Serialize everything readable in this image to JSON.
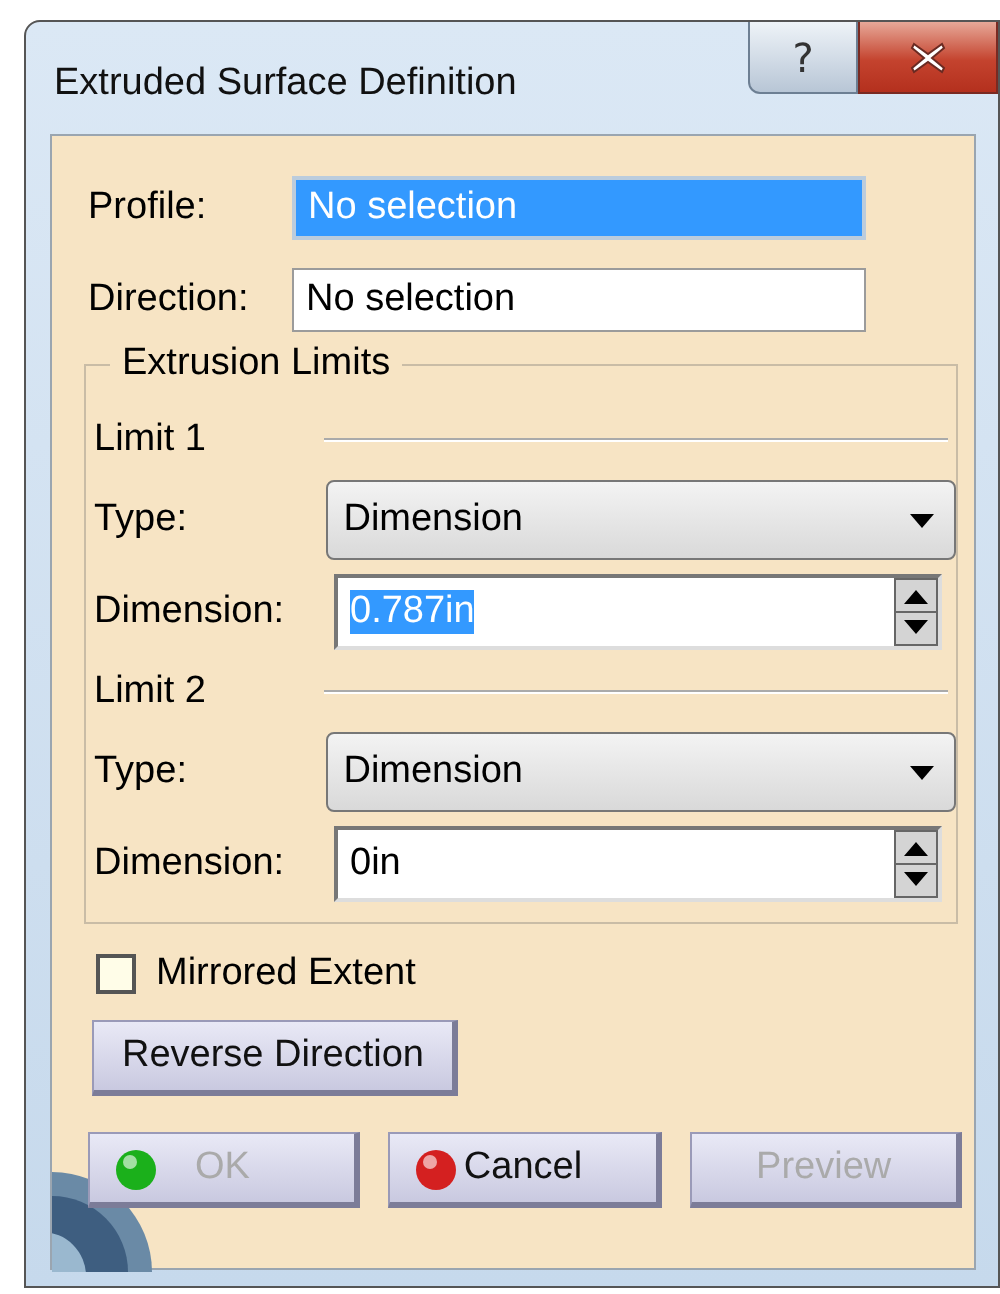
{
  "window": {
    "title": "Extruded Surface Definition",
    "help_button": "?"
  },
  "fields": [
    {
      "label": "Profile:",
      "value": "No selection",
      "selected": true
    },
    {
      "label": "Direction:",
      "value": "No selection",
      "selected": false
    }
  ],
  "group": {
    "title": "Extrusion Limits",
    "limits": [
      {
        "title": "Limit 1",
        "type_label": "Type:",
        "type_value": "Dimension",
        "dimension_label": "Dimension:",
        "dimension_value": "0.787in",
        "selected": true
      },
      {
        "title": "Limit 2",
        "type_label": "Type:",
        "type_value": "Dimension",
        "dimension_label": "Dimension:",
        "dimension_value": "0in",
        "selected": false
      }
    ]
  },
  "mirrored": {
    "label": "Mirrored Extent",
    "checked": false
  },
  "reverse_button": "Reverse Direction",
  "buttons": [
    {
      "label": "OK",
      "kind": "ok",
      "disabled": true
    },
    {
      "label": "Cancel",
      "kind": "cancel",
      "disabled": false
    },
    {
      "label": "Preview",
      "kind": "preview",
      "disabled": true
    }
  ]
}
